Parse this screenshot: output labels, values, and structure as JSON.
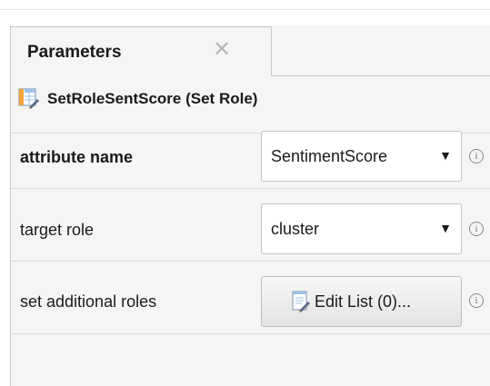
{
  "panel": {
    "tab_title": "Parameters",
    "tab_close_glyph": "✕",
    "operator_title": "SetRoleSentScore (Set Role)",
    "operator_icon": "set-role-icon"
  },
  "params": [
    {
      "label": "attribute name",
      "value": "SentimentScore",
      "type": "select"
    },
    {
      "label": "target role",
      "value": "cluster",
      "type": "select"
    },
    {
      "label": "set additional roles",
      "button_label": "Edit List (0)...",
      "type": "button",
      "icon": "edit-list-icon"
    }
  ],
  "info_glyph": "i",
  "dropdown_glyph": "▼",
  "colors": {
    "panel_bg": "#f5f5f5",
    "border": "#c9c9c9",
    "text": "#1a1a1a"
  }
}
